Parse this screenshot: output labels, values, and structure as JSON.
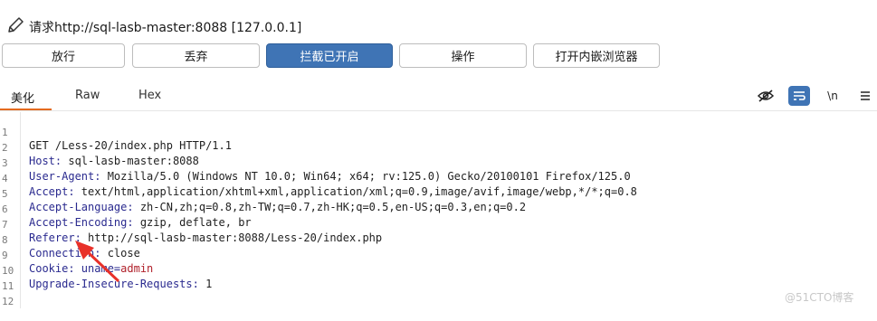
{
  "header": {
    "title": "请求http://sql-lasb-master:8088  [127.0.0.1]",
    "icon": "pencil-icon"
  },
  "toolbar": {
    "buttons": [
      {
        "label": "放行"
      },
      {
        "label": "丢弃"
      },
      {
        "label": "拦截已开启",
        "active": true
      },
      {
        "label": "操作"
      },
      {
        "label": "打开内嵌浏览器"
      }
    ],
    "accent_color": "#3f74b5"
  },
  "tabs": {
    "items": [
      {
        "label": "美化",
        "active": true
      },
      {
        "label": "Raw"
      },
      {
        "label": "Hex"
      }
    ],
    "tools": [
      {
        "icon": "eye-slash-icon"
      },
      {
        "icon": "wrap-icon",
        "selected": true
      },
      {
        "icon": "newline-icon",
        "label": "\\n"
      },
      {
        "icon": "menu-icon"
      }
    ]
  },
  "editor": {
    "lines": [
      {
        "n": "1",
        "name": "GET /Less-20/index.php HTTP/1.1",
        "value": ""
      },
      {
        "n": "2",
        "name": "Host:",
        "value": " sql-lasb-master:8088"
      },
      {
        "n": "3",
        "name": "User-Agent:",
        "value": " Mozilla/5.0 (Windows NT 10.0; Win64; x64; rv:125.0) Gecko/20100101 Firefox/125.0"
      },
      {
        "n": "4",
        "name": "Accept:",
        "value": " text/html,application/xhtml+xml,application/xml;q=0.9,image/avif,image/webp,*/*;q=0.8"
      },
      {
        "n": "5",
        "name": "Accept-Language:",
        "value": " zh-CN,zh;q=0.8,zh-TW;q=0.7,zh-HK;q=0.5,en-US;q=0.3,en;q=0.2"
      },
      {
        "n": "6",
        "name": "Accept-Encoding:",
        "value": " gzip, deflate, br"
      },
      {
        "n": "7",
        "name": "Referer:",
        "value": " http://sql-lasb-master:8088/Less-20/index.php"
      },
      {
        "n": "8",
        "name": "Connection:",
        "value": " close"
      },
      {
        "n": "9",
        "name": "Cookie:",
        "value": " uname=",
        "cookie": "admin"
      },
      {
        "n": "10",
        "name": "Upgrade-Insecure-Requests:",
        "value": " 1"
      },
      {
        "n": "11",
        "name": "",
        "value": ""
      },
      {
        "n": "12",
        "name": "",
        "value": ""
      }
    ]
  },
  "annotation": {
    "color": "#e8312a"
  },
  "watermark": "@51CTO博客"
}
